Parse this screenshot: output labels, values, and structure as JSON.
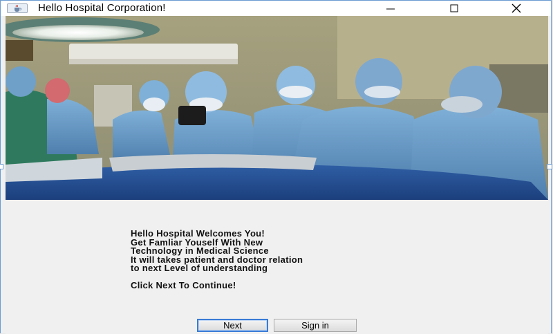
{
  "window": {
    "title": "Hello Hospital Corporation!",
    "icon": "java-cup-icon"
  },
  "controls": {
    "minimize_icon": "minimize-icon",
    "maximize_icon": "maximize-icon",
    "close_icon": "close-icon"
  },
  "hero": {
    "description_icon": "surgeons-photo"
  },
  "message": {
    "line1": "Hello Hospital Welcomes You!",
    "line2": "Get Famliar Youself With New",
    "line3": "Technology in Medical Science",
    "line4": "It will takes patient and doctor relation",
    "line5": "to next Level of understanding",
    "line6": "Click Next To Continue!"
  },
  "buttons": {
    "next": "Next",
    "signin": "Sign in"
  },
  "colors": {
    "window_border": "#6b9bd2",
    "background": "#f0f0f0",
    "focus_border": "#3a7bd5"
  }
}
